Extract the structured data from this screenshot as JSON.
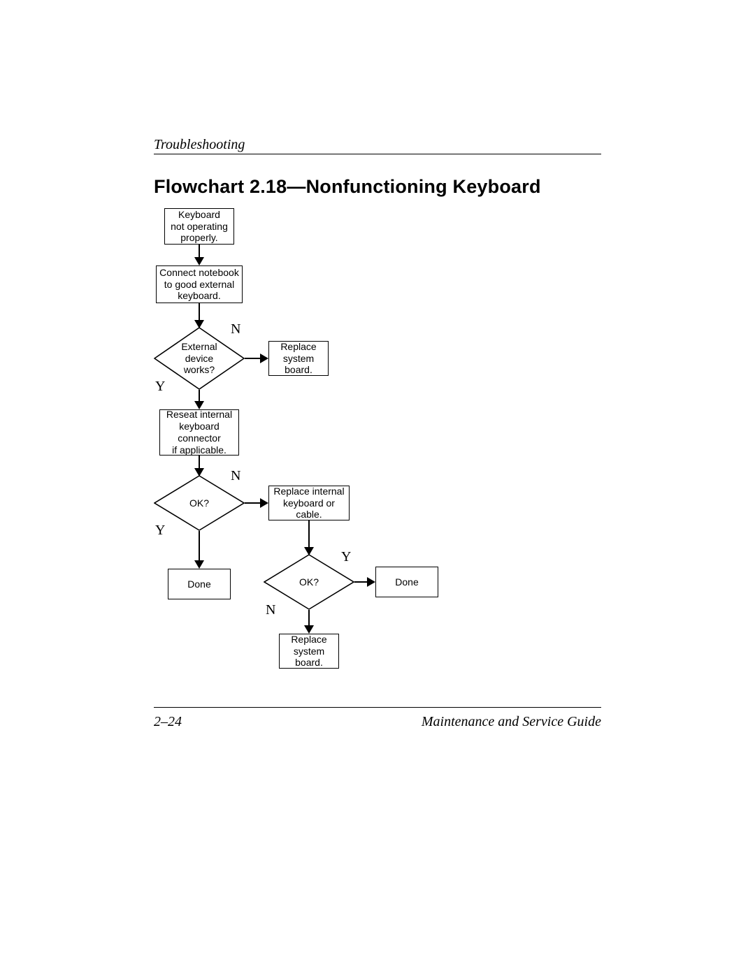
{
  "header": {
    "section": "Troubleshooting",
    "title": "Flowchart 2.18—Nonfunctioning Keyboard"
  },
  "footer": {
    "page": "2–24",
    "guide": "Maintenance and Service Guide"
  },
  "nodes": {
    "start": "Keyboard\nnot operating\nproperly.",
    "connect": "Connect notebook\nto good external\nkeyboard.",
    "ext_works": "External\ndevice\nworks?",
    "replace_sb1": "Replace\nsystem\nboard.",
    "reseat": "Reseat internal\nkeyboard\nconnector\nif applicable.",
    "ok1": "OK?",
    "replace_kb": "Replace internal\nkeyboard or\ncable.",
    "done1": "Done",
    "ok2": "OK?",
    "done2": "Done",
    "replace_sb2": "Replace\nsystem\nboard."
  },
  "labels": {
    "yes": "Y",
    "no": "N"
  }
}
